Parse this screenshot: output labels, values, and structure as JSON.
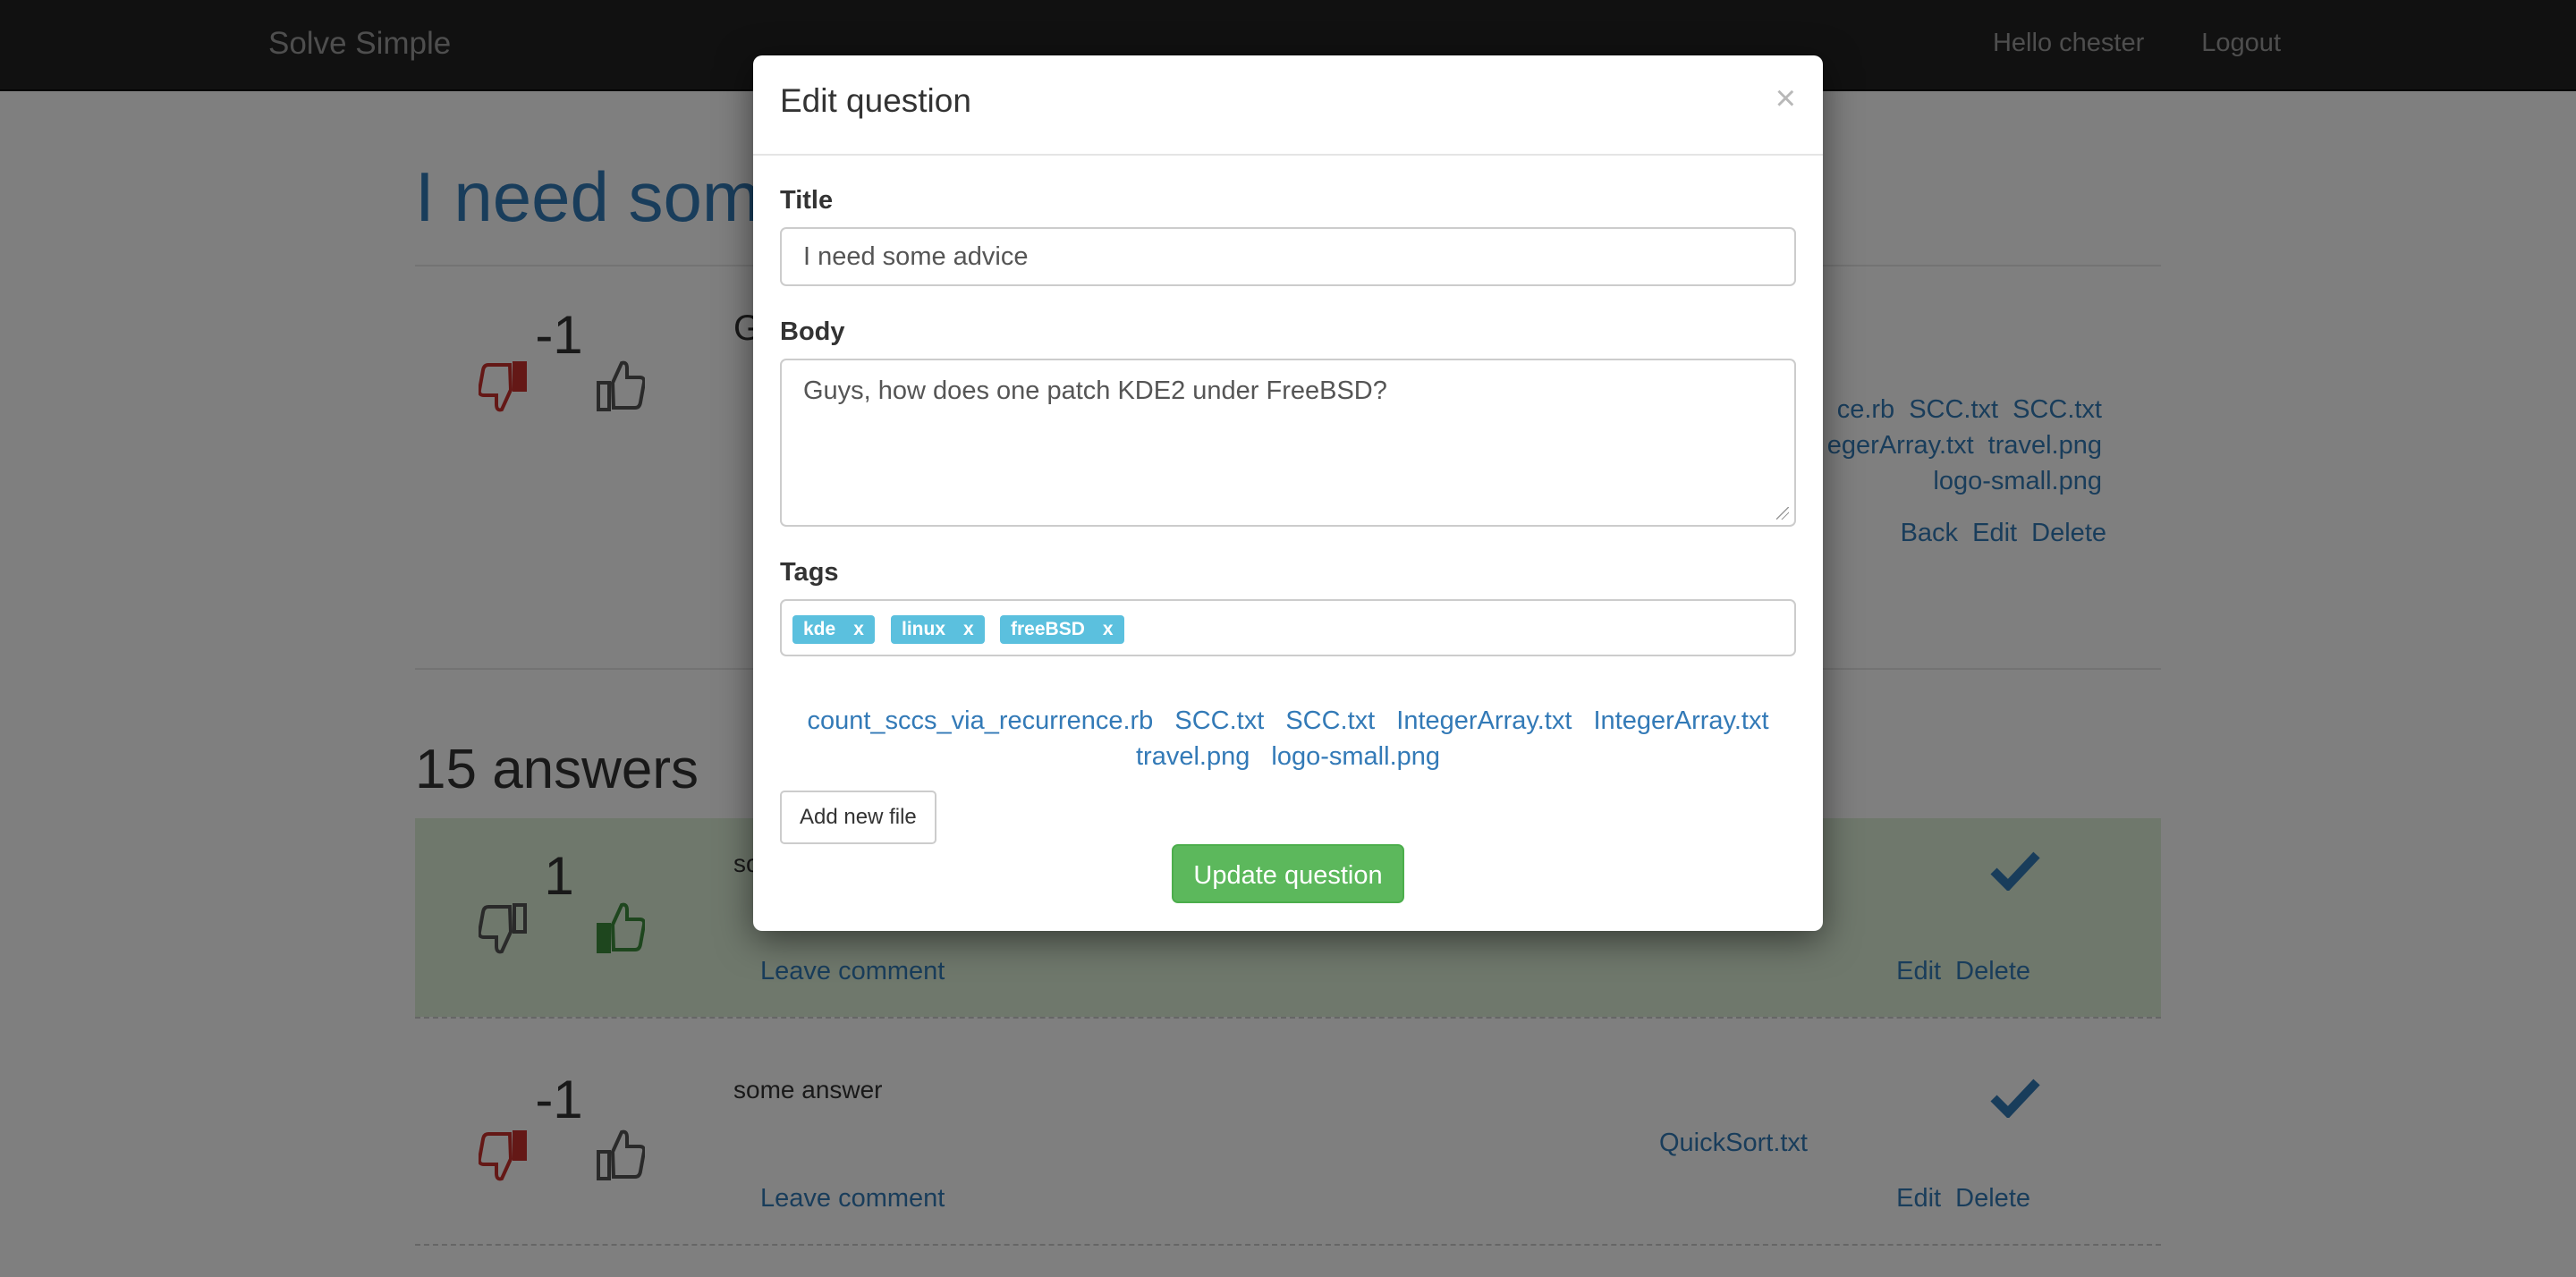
{
  "navbar": {
    "brand": "Solve Simple",
    "greeting": "Hello chester",
    "logout": "Logout"
  },
  "question": {
    "title": "I need some advice",
    "score": "-1",
    "body_visible": "G",
    "files": [
      [
        "ce.rb",
        "SCC.txt",
        "SCC.txt"
      ],
      [
        "egerArray.txt",
        "travel.png"
      ],
      [
        "logo-small.png"
      ]
    ],
    "actions": {
      "back": "Back",
      "edit": "Edit",
      "delete": "Delete"
    }
  },
  "answers": {
    "heading": "15 answers",
    "items": [
      {
        "score": "1",
        "text": "so",
        "leave_comment": "Leave comment",
        "edit": "Edit",
        "delete": "Delete",
        "accepted": true
      },
      {
        "score": "-1",
        "text": "some answer",
        "file": "QuickSort.txt",
        "leave_comment": "Leave comment",
        "edit": "Edit",
        "delete": "Delete",
        "accepted": false
      }
    ]
  },
  "modal": {
    "title": "Edit question",
    "close": "×",
    "title_label": "Title",
    "title_value": "I need some advice",
    "body_label": "Body",
    "body_value": "Guys, how does one patch KDE2 under FreeBSD?",
    "tags_label": "Tags",
    "tags": [
      {
        "name": "kde",
        "remove": "x"
      },
      {
        "name": "linux",
        "remove": "x"
      },
      {
        "name": "freeBSD",
        "remove": "x"
      }
    ],
    "files": [
      "count_sccs_via_recurrence.rb",
      "SCC.txt",
      "SCC.txt",
      "IntegerArray.txt",
      "IntegerArray.txt",
      "travel.png",
      "logo-small.png"
    ],
    "add_file": "Add new file",
    "submit": "Update question"
  },
  "icons": {
    "thumbs_down": "thumbs-down-icon",
    "thumbs_up": "thumbs-up-icon",
    "check": "check-icon"
  },
  "colors": {
    "link": "#337ab7",
    "tag": "#5bc0de",
    "success": "#5cb85c",
    "downvoted": "#c9302c",
    "upvoted": "#3c8d3c",
    "accepted_bg": "#dff0d8"
  }
}
